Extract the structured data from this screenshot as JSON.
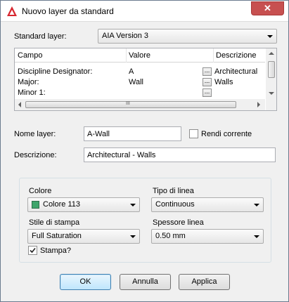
{
  "window": {
    "title": "Nuovo layer da standard",
    "icon": "autocad-icon",
    "close_glyph": "✕"
  },
  "standard_layer": {
    "label": "Standard layer:",
    "value": "AIA Version 3"
  },
  "grid": {
    "columns": [
      "Campo",
      "Valore",
      "Descrizione"
    ],
    "rows": [
      {
        "campo": "Discipline Designator:",
        "valore": "A",
        "descrizione": "Architectural"
      },
      {
        "campo": "Major:",
        "valore": "Wall",
        "descrizione": "Walls"
      },
      {
        "campo": "Minor 1:",
        "valore": "",
        "descrizione": ""
      }
    ],
    "ellipsis_label": "...",
    "hscroll_grip": "III"
  },
  "layer_name": {
    "label": "Nome layer:",
    "value": "A-Wall"
  },
  "make_current": {
    "label": "Rendi corrente",
    "checked": false
  },
  "description": {
    "label": "Descrizione:",
    "value": "Architectural - Walls"
  },
  "properties": {
    "color": {
      "label": "Colore",
      "value": "Colore 113",
      "swatch": "#3ea56b"
    },
    "linetype": {
      "label": "Tipo di linea",
      "value": "Continuous"
    },
    "plot_style": {
      "label": "Stile di stampa",
      "value": "Full Saturation"
    },
    "lineweight": {
      "label": "Spessore linea",
      "value": "0.50 mm"
    },
    "plot": {
      "label": "Stampa?",
      "checked": true
    }
  },
  "buttons": {
    "ok": "OK",
    "cancel": "Annulla",
    "apply": "Applica"
  }
}
